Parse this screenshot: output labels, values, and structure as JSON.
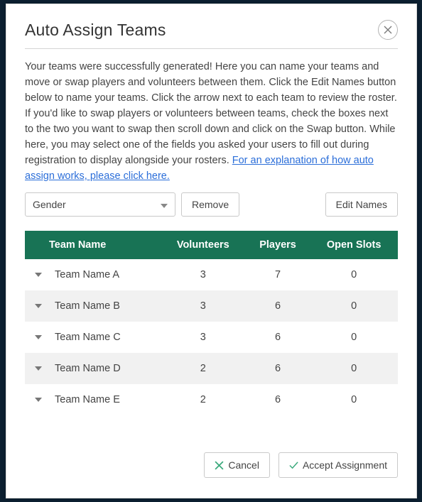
{
  "dialog": {
    "title": "Auto Assign Teams",
    "description": "Your teams were successfully generated! Here you can name your teams and move or swap players and volunteers between them. Click the Edit Names button below to name your teams. Click the arrow next to each team to review the roster. If you'd like to swap players or volunteers between teams, check the boxes next to the two you want to swap then scroll down and click on the Swap button. While here, you may select one of the fields you asked your users to fill out during registration to display alongside your rosters. ",
    "link_text": "For an explanation of how auto assign works, please click here."
  },
  "controls": {
    "filter_select": "Gender",
    "remove": "Remove",
    "edit_names": "Edit Names"
  },
  "table": {
    "headers": {
      "team": "Team Name",
      "volunteers": "Volunteers",
      "players": "Players",
      "open_slots": "Open Slots"
    },
    "rows": [
      {
        "name": "Team Name A",
        "volunteers": "3",
        "players": "7",
        "open_slots": "0"
      },
      {
        "name": "Team Name B",
        "volunteers": "3",
        "players": "6",
        "open_slots": "0"
      },
      {
        "name": "Team Name C",
        "volunteers": "3",
        "players": "6",
        "open_slots": "0"
      },
      {
        "name": "Team Name D",
        "volunteers": "2",
        "players": "6",
        "open_slots": "0"
      },
      {
        "name": "Team Name E",
        "volunteers": "2",
        "players": "6",
        "open_slots": "0"
      }
    ]
  },
  "footer": {
    "cancel": "Cancel",
    "accept": "Accept Assignment"
  }
}
